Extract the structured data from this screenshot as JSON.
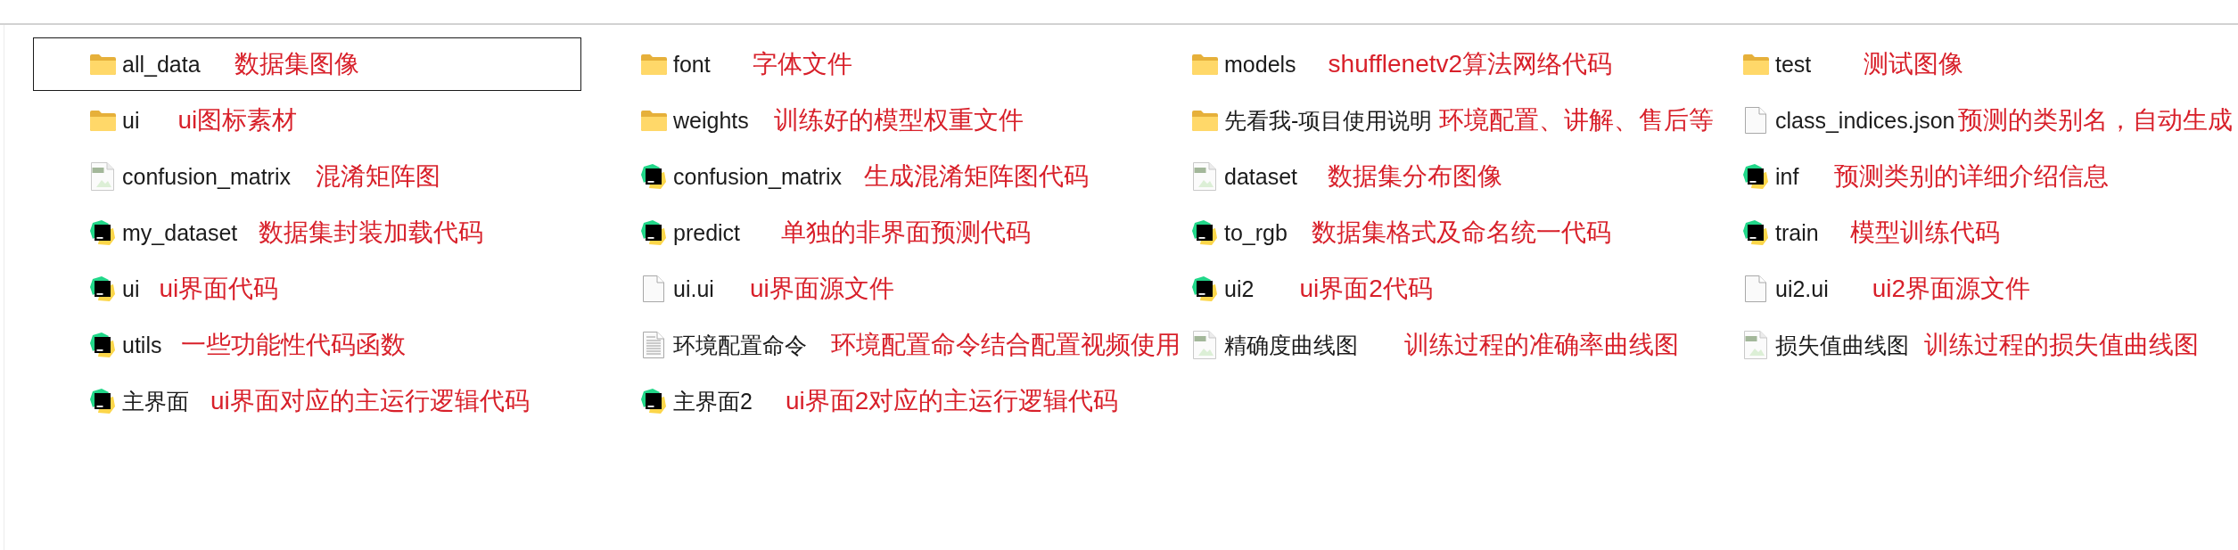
{
  "files": [
    {
      "name": "all_data",
      "kind": "folder",
      "selected": true,
      "annotation": "数据集图像"
    },
    {
      "name": "font",
      "kind": "folder",
      "selected": false,
      "annotation": "字体文件"
    },
    {
      "name": "models",
      "kind": "folder",
      "selected": false,
      "annotation": "shufflenetv2算法网络代码"
    },
    {
      "name": "test",
      "kind": "folder",
      "selected": false,
      "annotation": "测试图像"
    },
    {
      "name": "ui",
      "kind": "folder",
      "selected": false,
      "annotation": "ui图标素材"
    },
    {
      "name": "weights",
      "kind": "folder",
      "selected": false,
      "annotation": "训练好的模型权重文件"
    },
    {
      "name": "先看我-项目使用说明",
      "kind": "folder",
      "selected": false,
      "annotation": "环境配置、讲解、售后等"
    },
    {
      "name": "class_indices.json",
      "kind": "blank",
      "selected": false,
      "annotation": "预测的类别名，自动生成"
    },
    {
      "name": "confusion_matrix",
      "kind": "image",
      "selected": false,
      "annotation": "混淆矩阵图"
    },
    {
      "name": "confusion_matrix",
      "kind": "python",
      "selected": false,
      "annotation": "生成混淆矩阵图代码"
    },
    {
      "name": "dataset",
      "kind": "image",
      "selected": false,
      "annotation": "数据集分布图像"
    },
    {
      "name": "inf",
      "kind": "python",
      "selected": false,
      "annotation": "预测类别的详细介绍信息"
    },
    {
      "name": "my_dataset",
      "kind": "python",
      "selected": false,
      "annotation": "数据集封装加载代码"
    },
    {
      "name": "predict",
      "kind": "python",
      "selected": false,
      "annotation": "单独的非界面预测代码"
    },
    {
      "name": "to_rgb",
      "kind": "python",
      "selected": false,
      "annotation": "数据集格式及命名统一代码"
    },
    {
      "name": "train",
      "kind": "python",
      "selected": false,
      "annotation": "模型训练代码"
    },
    {
      "name": "ui",
      "kind": "python",
      "selected": false,
      "annotation": "ui界面代码"
    },
    {
      "name": "ui.ui",
      "kind": "blank",
      "selected": false,
      "annotation": "ui界面源文件"
    },
    {
      "name": "ui2",
      "kind": "python",
      "selected": false,
      "annotation": "ui界面2代码"
    },
    {
      "name": "ui2.ui",
      "kind": "blank",
      "selected": false,
      "annotation": "ui2界面源文件"
    },
    {
      "name": "utils",
      "kind": "python",
      "selected": false,
      "annotation": "一些功能性代码函数"
    },
    {
      "name": "环境配置命令",
      "kind": "text",
      "selected": false,
      "annotation": "环境配置命令结合配置视频使用"
    },
    {
      "name": "精确度曲线图",
      "kind": "image",
      "selected": false,
      "annotation": "训练过程的准确率曲线图"
    },
    {
      "name": "损失值曲线图",
      "kind": "image",
      "selected": false,
      "annotation": "训练过程的损失值曲线图"
    },
    {
      "name": "主界面",
      "kind": "python",
      "selected": false,
      "annotation": "ui界面对应的主运行逻辑代码"
    },
    {
      "name": "主界面2",
      "kind": "python",
      "selected": false,
      "annotation": "ui界面2对应的主运行逻辑代码"
    }
  ]
}
